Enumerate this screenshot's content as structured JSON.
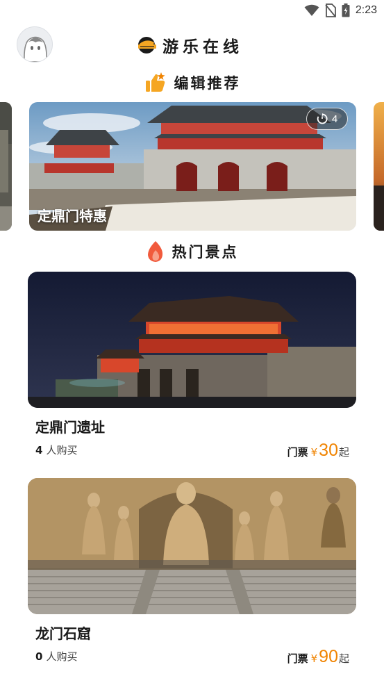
{
  "status_bar": {
    "time": "2:23",
    "icons": [
      "wifi-icon",
      "no-sim-icon",
      "battery-icon"
    ]
  },
  "header": {
    "app_title": "游乐在线",
    "avatar": "avatar-icon",
    "logo": "logo-icon"
  },
  "featured": {
    "title": "编辑推荐",
    "icon": "thumbs-up-icon",
    "banner": {
      "title": "定鼎门特惠",
      "count": "4"
    }
  },
  "hot": {
    "title": "热门景点",
    "icon": "flame-icon",
    "items": [
      {
        "name": "定鼎门遗址",
        "buyers": "4",
        "buyers_suffix": "人购买",
        "price_label": "门票",
        "currency": "¥",
        "price": "30",
        "price_suffix": "起"
      },
      {
        "name": "龙门石窟",
        "buyers": "0",
        "buyers_suffix": "人购买",
        "price_label": "门票",
        "currency": "¥",
        "price": "90",
        "price_suffix": "起"
      }
    ]
  },
  "colors": {
    "accent": "#f08300",
    "flame": "#f15a3c",
    "thumb": "#f5a623"
  }
}
